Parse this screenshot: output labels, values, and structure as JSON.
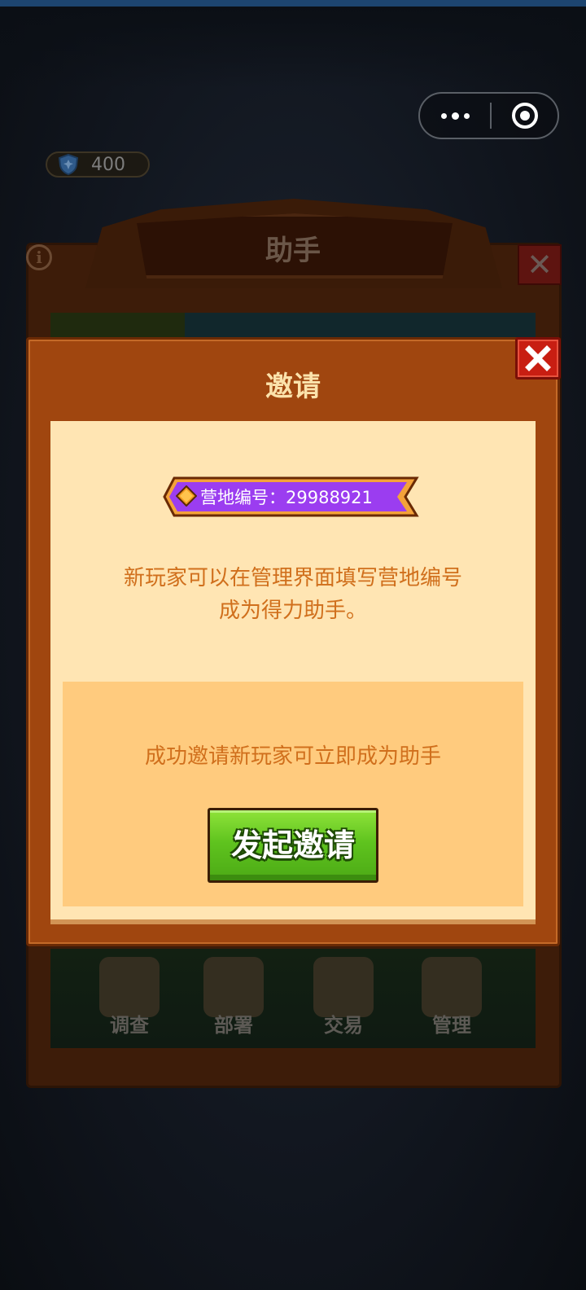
{
  "shield_counter": {
    "value": "400",
    "icon": "shield-icon"
  },
  "background_panel": {
    "title": "助手",
    "tabs": [
      {
        "label": "调查",
        "icon": "search-icon"
      },
      {
        "label": "部署",
        "icon": "map-pin-icon"
      },
      {
        "label": "交易",
        "icon": "trade-icon"
      },
      {
        "label": "管理",
        "icon": "gear-icon"
      }
    ]
  },
  "dialog": {
    "title": "邀请",
    "camp_label": "营地编号：",
    "camp_id": "29988921",
    "description_line1": "新玩家可以在管理界面填写营地编号",
    "description_line2": "成为得力助手。",
    "sub_text": "成功邀请新玩家可立即成为助手",
    "invite_button": "发起邀请"
  },
  "colors": {
    "dialog_bg": "#a0460f",
    "content_bg": "#ffe5b3",
    "accent_text": "#d06f1c",
    "badge_purple": "#9b3df0",
    "button_green": "#5fc31e",
    "close_red": "#c81e12"
  }
}
